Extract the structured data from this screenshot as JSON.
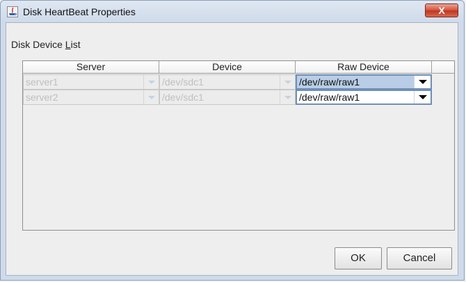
{
  "window": {
    "title": "Disk HeartBeat Properties",
    "close_label": "X"
  },
  "section": {
    "label_prefix": "Disk Device ",
    "label_mnemonic": "L",
    "label_suffix": "ist"
  },
  "table": {
    "columns": [
      "Server",
      "Device",
      "Raw Device"
    ],
    "rows": [
      {
        "server": "server1",
        "device": "/dev/sdc1",
        "raw_device": "/dev/raw/raw1"
      },
      {
        "server": "server2",
        "device": "/dev/sdc1",
        "raw_device": "/dev/raw/raw1"
      }
    ]
  },
  "buttons": {
    "ok": "OK",
    "cancel": "Cancel"
  }
}
